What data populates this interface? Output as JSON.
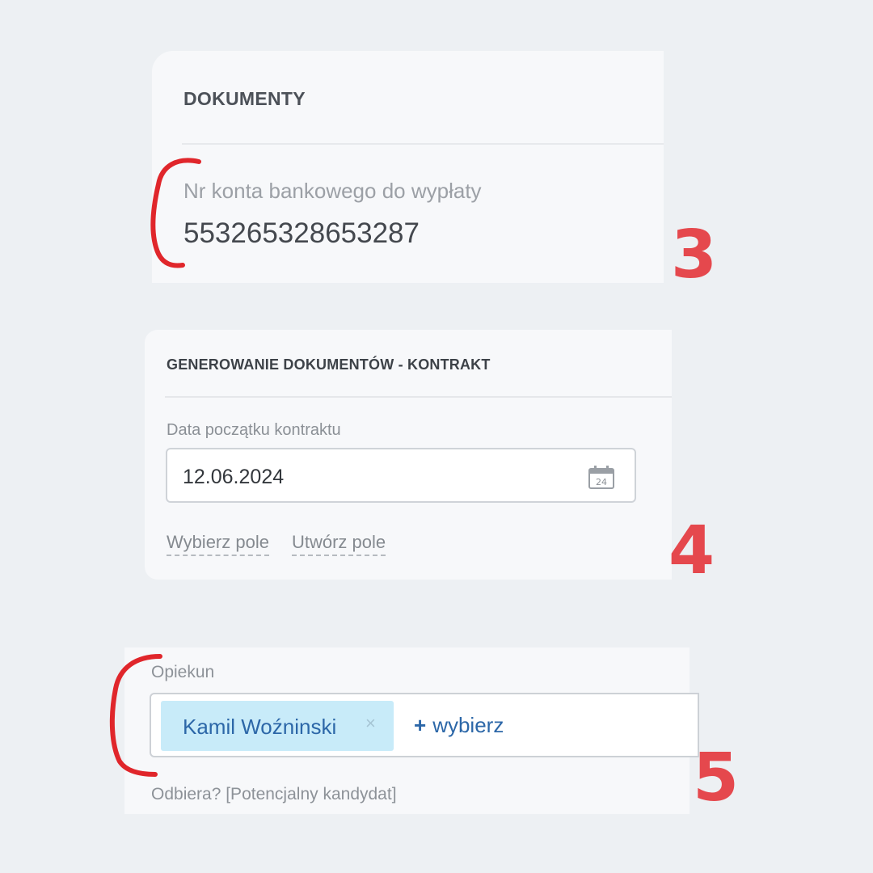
{
  "documents": {
    "title": "DOKUMENTY",
    "bank_label": "Nr konta bankowego do wypłaty",
    "bank_value": "553265328653287"
  },
  "generation": {
    "title": "GENEROWANIE DOKUMENTÓW - KONTRAKT",
    "date_label": "Data początku kontraktu",
    "date_value": "12.06.2024",
    "calendar_day": "24",
    "link_choose": "Wybierz pole",
    "link_create": "Utwórz pole"
  },
  "guardian": {
    "label": "Opiekun",
    "tag": "Kamil Woźninski",
    "tag_remove": "×",
    "add_plus": "+",
    "add_label": "wybierz",
    "bottom_label": "Odbiera? [Potencjalny kandydat]"
  },
  "step_numbers": [
    "3",
    "4",
    "5"
  ],
  "colors": {
    "annotation_red": "#e5484d",
    "tag_bg": "#c8ebf9",
    "tag_text": "#2c67a8"
  }
}
